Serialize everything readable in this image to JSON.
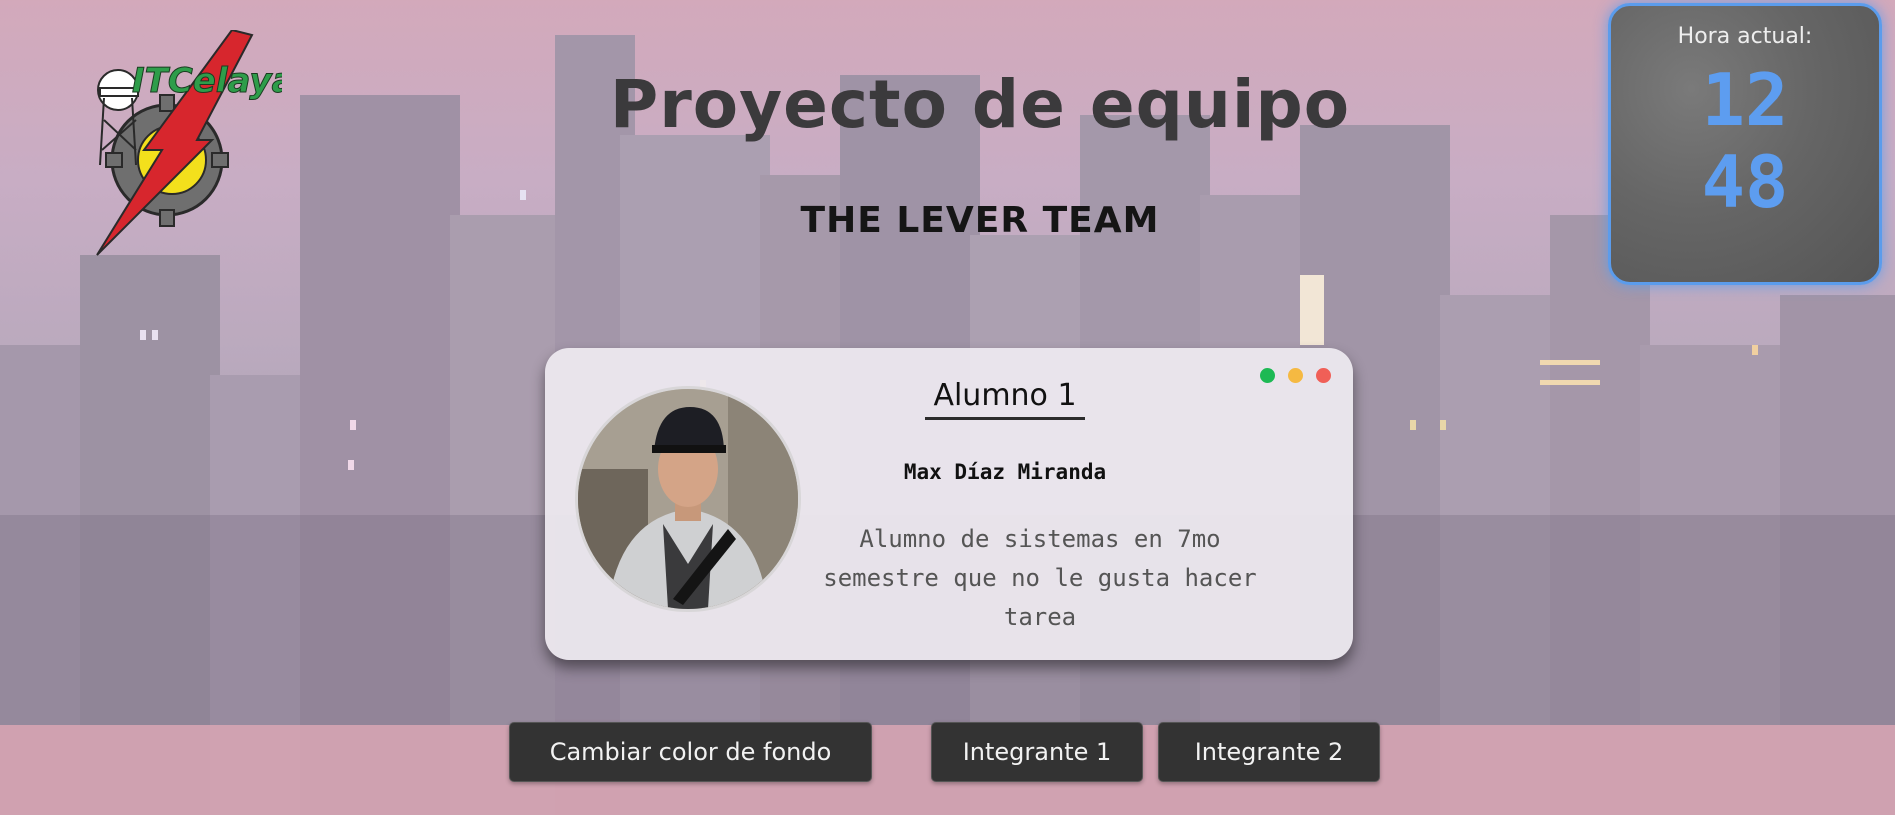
{
  "header": {
    "title": "Proyecto de equipo",
    "team_name": "THE LEVER TEAM"
  },
  "logo": {
    "text": "ITCelaya",
    "icon": "itcelaya-logo-icon"
  },
  "clock": {
    "label": "Hora actual:",
    "hour": "12",
    "minute": "48"
  },
  "card": {
    "title": "Alumno 1",
    "name": "Max Díaz Miranda",
    "description": "Alumno de sistemas en 7mo semestre que no le gusta hacer tarea",
    "photo_icon": "student-photo",
    "window_dots": [
      "#1db954",
      "#f5b942",
      "#f05f57"
    ]
  },
  "buttons": {
    "change_bg": "Cambiar color de fondo",
    "member1": "Integrante 1",
    "member2": "Integrante 2"
  },
  "colors": {
    "accent": "#5d9df0",
    "button_bg": "#333333",
    "title_color": "#3b3a3c"
  }
}
